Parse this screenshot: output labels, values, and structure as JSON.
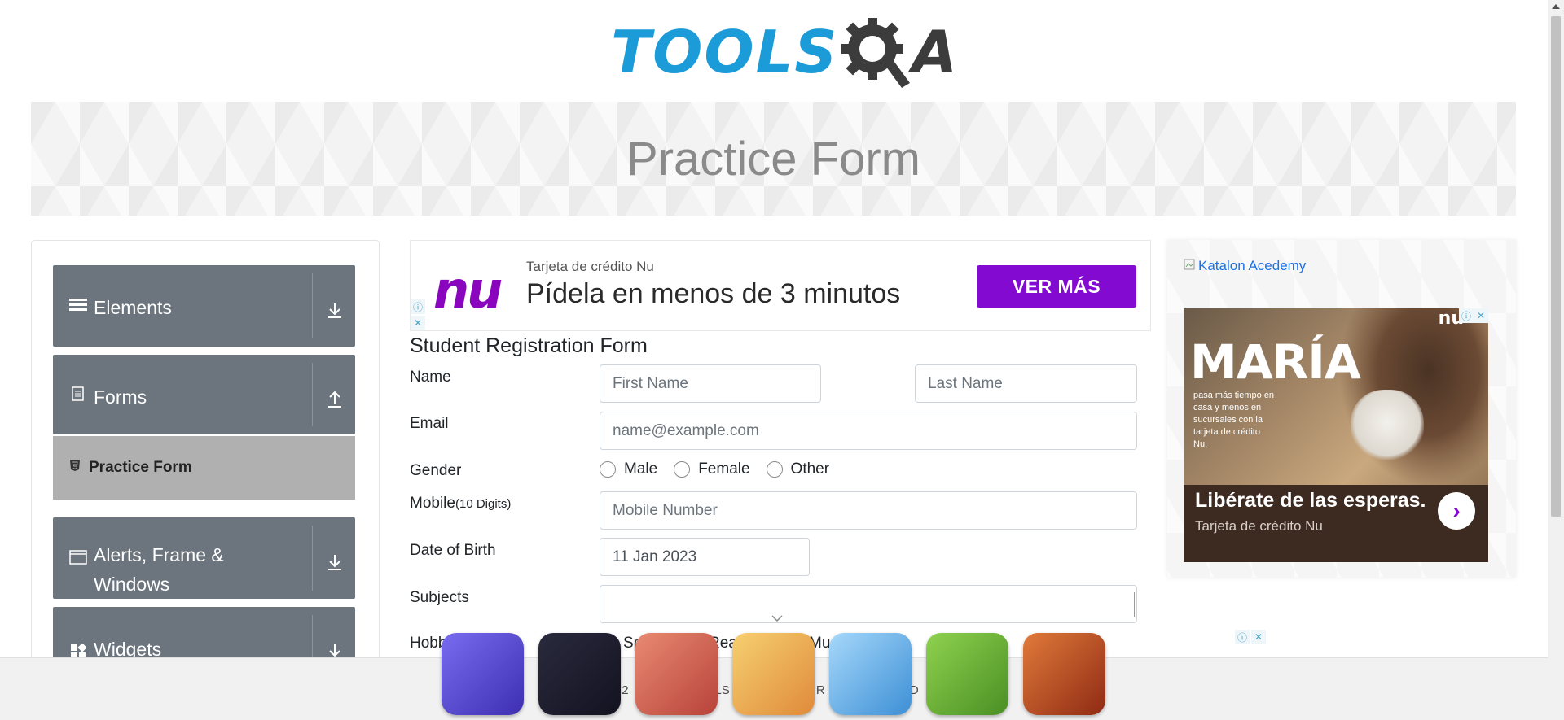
{
  "header": {
    "logo_text_left": "TOOLS",
    "logo_text_right": "A"
  },
  "banner": {
    "title": "Practice Form"
  },
  "sidebar": {
    "groups": [
      {
        "label": "Elements",
        "icon": "hamburger-icon",
        "arrow": "download-arrow-icon"
      },
      {
        "label": "Forms",
        "icon": "document-icon",
        "arrow": "upload-arrow-icon"
      },
      {
        "label": "Alerts, Frame & Windows",
        "icon": "window-icon",
        "arrow": "download-arrow-icon"
      },
      {
        "label": "Widgets",
        "icon": "widgets-icon",
        "arrow": "download-arrow-icon"
      }
    ],
    "active_item": {
      "label": "Practice Form",
      "icon": "html5-icon"
    }
  },
  "ad_top": {
    "logo": "nu",
    "subtitle": "Tarjeta de crédito Nu",
    "headline": "Pídela en menos de 3 minutos",
    "button": "VER MÁS"
  },
  "form": {
    "title": "Student Registration Form",
    "name_label": "Name",
    "first_name_placeholder": "First Name",
    "last_name_placeholder": "Last Name",
    "email_label": "Email",
    "email_placeholder": "name@example.com",
    "gender_label": "Gender",
    "gender_options": [
      "Male",
      "Female",
      "Other"
    ],
    "mobile_label": "Mobile",
    "mobile_hint": "(10 Digits)",
    "mobile_placeholder": "Mobile Number",
    "dob_label": "Date of Birth",
    "dob_value": "11 Jan 2023",
    "subjects_label": "Subjects",
    "subjects_value": "",
    "hobbies_label_partial": "Hobb",
    "hobbies_partial": [
      "Sp",
      "Rea",
      "Mu"
    ]
  },
  "ad_right": {
    "link_text": "Katalon Acedemy",
    "brand": "nu",
    "name": "MARÍA",
    "body": "pasa más tiempo en casa y menos en sucursales con la tarjeta de crédito Nu.",
    "headline": "Libérate de las esperas.",
    "subtitle": "Tarjeta de crédito Nu"
  },
  "footer": {
    "text_partial_1": "© 2",
    "text_partial_2": "OLS",
    "text_partial_3": "L R",
    "text_partial_4": "ED"
  },
  "games": [
    {
      "name": "squid-game-icon",
      "color": "#5a4bd6"
    },
    {
      "name": "friday-night-funkin-icon",
      "color": "#1d1d2e"
    },
    {
      "name": "hair-salon-icon",
      "color": "#d65a4a"
    },
    {
      "name": "fruit-mouth-icon",
      "color": "#f0b94a"
    },
    {
      "name": "dentist-icon",
      "color": "#6fb8f0"
    },
    {
      "name": "pin-puzzle-icon",
      "color": "#6bb13a"
    },
    {
      "name": "fruit-ninja-icon",
      "color": "#c14f2a"
    }
  ],
  "colors": {
    "brand_blue": "#1b9bd7",
    "nav_gray": "#6c757d",
    "active_gray": "#b0b0b0",
    "nu_purple": "#820ad1"
  }
}
